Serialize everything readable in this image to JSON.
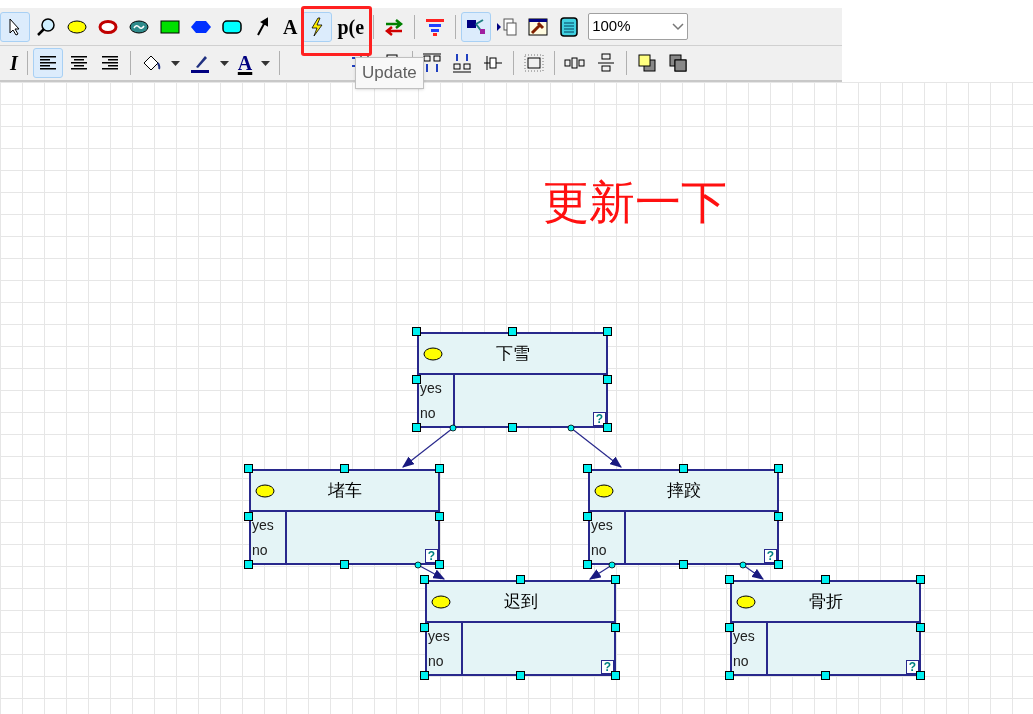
{
  "toolbar_1": [
    {
      "kind": "pointer",
      "selected": true
    },
    {
      "kind": "zoom",
      "selected": false
    },
    {
      "kind": "ellipse",
      "selected": false
    },
    {
      "kind": "ring",
      "selected": false
    },
    {
      "kind": "wave",
      "selected": false
    },
    {
      "kind": "rect",
      "selected": false
    },
    {
      "kind": "hexagon",
      "selected": false
    },
    {
      "kind": "rounded",
      "selected": false
    },
    {
      "kind": "arrow",
      "selected": false
    },
    {
      "kind": "letter",
      "label": "A",
      "selected": false
    },
    {
      "kind": "lightning",
      "selected": true
    },
    {
      "kind": "letter",
      "label": "p(e",
      "selected": false
    },
    {
      "kind": "separator"
    },
    {
      "kind": "swap",
      "selected": false
    },
    {
      "kind": "separator"
    },
    {
      "kind": "funnel",
      "selected": false
    },
    {
      "kind": "separator"
    },
    {
      "kind": "network",
      "selected": true
    },
    {
      "kind": "copy",
      "selected": false
    },
    {
      "kind": "hammer",
      "selected": false
    },
    {
      "kind": "calculator",
      "selected": false
    }
  ],
  "zoom": {
    "value": "100%"
  },
  "toolbar_2": [
    {
      "kind": "italic",
      "label": "I",
      "selected": false
    },
    {
      "kind": "separator"
    },
    {
      "kind": "align-left",
      "selected": true
    },
    {
      "kind": "align-center",
      "selected": false
    },
    {
      "kind": "align-right",
      "selected": false
    },
    {
      "kind": "separator"
    },
    {
      "kind": "bucket",
      "selected": false
    },
    {
      "kind": "caret",
      "selected": false
    },
    {
      "kind": "pen",
      "selected": false
    },
    {
      "kind": "caret",
      "selected": false
    },
    {
      "kind": "font-color",
      "label": "A",
      "selected": false
    },
    {
      "kind": "caret",
      "selected": false
    },
    {
      "kind": "separator"
    },
    {
      "kind": "blank"
    },
    {
      "kind": "align-in",
      "selected": false
    },
    {
      "kind": "align-mid",
      "selected": false
    },
    {
      "kind": "separator"
    },
    {
      "kind": "align-top",
      "selected": false
    },
    {
      "kind": "align-bottom",
      "selected": false
    },
    {
      "kind": "align-vmid",
      "selected": false
    },
    {
      "kind": "separator"
    },
    {
      "kind": "grid-select",
      "selected": false
    },
    {
      "kind": "separator"
    },
    {
      "kind": "space-h",
      "selected": false
    },
    {
      "kind": "space-v",
      "selected": false
    },
    {
      "kind": "separator"
    },
    {
      "kind": "front",
      "selected": false
    },
    {
      "kind": "back",
      "selected": false
    }
  ],
  "tooltip": "Update",
  "annotation": "更新一下",
  "nodes": [
    {
      "title": "下雪",
      "states": [
        "yes",
        "no"
      ],
      "mark": "?",
      "selected": true
    },
    {
      "title": "堵车",
      "states": [
        "yes",
        "no"
      ],
      "mark": "?",
      "selected": true
    },
    {
      "title": "摔跤",
      "states": [
        "yes",
        "no"
      ],
      "mark": "?",
      "selected": true
    },
    {
      "title": "迟到",
      "states": [
        "yes",
        "no"
      ],
      "mark": "?",
      "selected": true
    },
    {
      "title": "骨折",
      "states": [
        "yes",
        "no"
      ],
      "mark": "?",
      "selected": true
    }
  ]
}
